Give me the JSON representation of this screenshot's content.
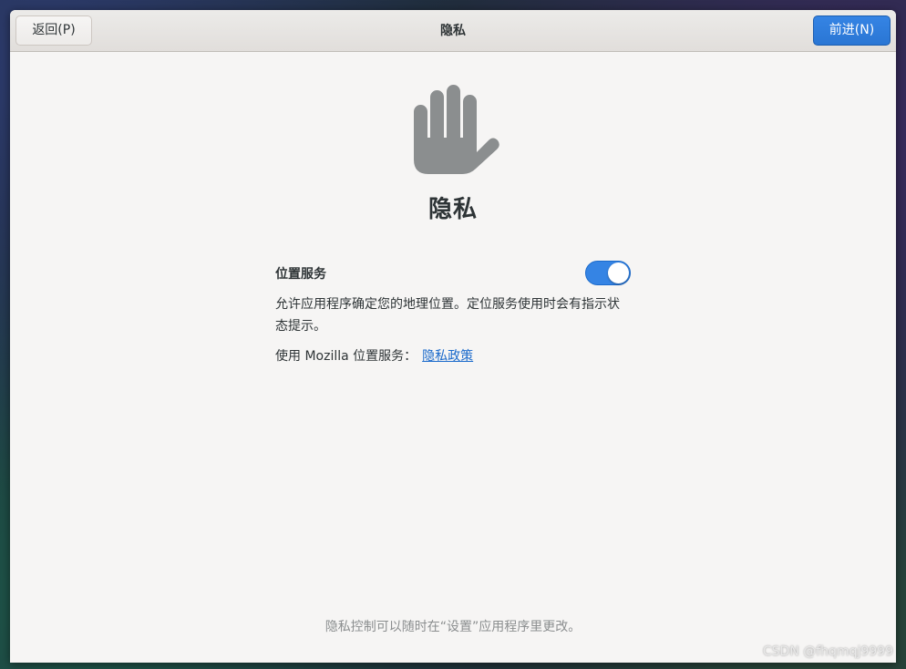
{
  "header": {
    "title": "隐私",
    "back_label": "返回(P)",
    "next_label": "前进(N)"
  },
  "main": {
    "icon": "hand-stop-icon",
    "title": "隐私",
    "location": {
      "label": "位置服务",
      "enabled": true,
      "description": "允许应用程序确定您的地理位置。定位服务使用时会有指示状态提示。",
      "mozilla_text": "使用 Mozilla 位置服务：",
      "policy_link": "隐私政策"
    },
    "footer_note": "隐私控制可以随时在“设置”应用程序里更改。"
  },
  "watermark": "CSDN @fhqmqj9999",
  "colors": {
    "accent": "#3584e4",
    "link": "#1b6acb",
    "icon": "#8b8e8f",
    "window_bg": "#f6f5f4"
  }
}
